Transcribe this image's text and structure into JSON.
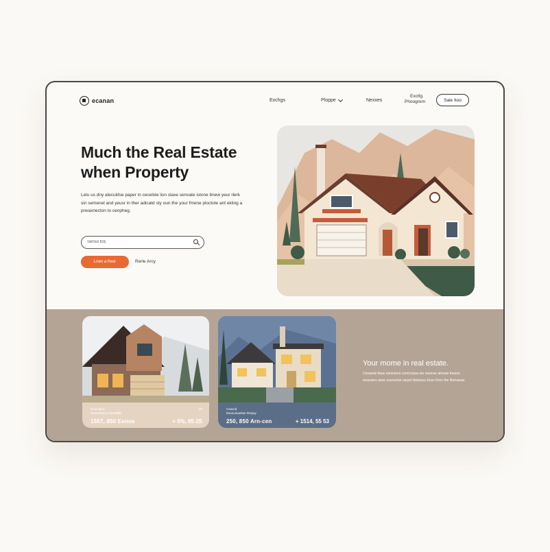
{
  "nav": {
    "logo_text": "ecanan",
    "links": [
      "Exchgs",
      "Ploppe",
      "Nexxes"
    ],
    "links_multiline": [
      "Exctfg",
      "Phoogrem"
    ],
    "button_label": "Sale Itoo"
  },
  "hero": {
    "title_line1": "Much the Real Estate",
    "title_line2": "when Property",
    "description": "Lelu us dny aleculdse paper in cecelste lisn slaxe senvate istone bnew yeur rlerk sin semenel and yeusr in ther adicatd sty oun the your fmene ploctote ant ekling a prwaxnecton to cenpheg.",
    "search_placeholder": "Senso tclc",
    "primary_cta": "Lnen a freor",
    "secondary_cta": "Rerle Arcy"
  },
  "listings": [
    {
      "subtitle_line1": "Emenaker",
      "subtitle_line2": "Saeeanteme Rirntaflbe",
      "tag": "cb",
      "price": "1557, 850 Eenoe",
      "price_secondary": "+ 5%, 65 2S"
    },
    {
      "subtitle_line1": "Csaxod",
      "subtitle_line2": "Dsseoinaettse Retyay",
      "price": "250, 850 Arn-cen",
      "price_secondary": "+ 1514, 55 53"
    }
  ],
  "promo": {
    "title": "Your mome in real estate.",
    "text": "Cenaene fiase omsmeno cnmrcnyas tsn nsemse alnewe fnesne eceeanrs anne snensrme nsrpnl Nsttsaxs Ensn Rnrn the Rnrnasse."
  },
  "colors": {
    "accent": "#e86a33",
    "footer_band": "#b4a496",
    "page_bg": "#fbf9f5"
  }
}
